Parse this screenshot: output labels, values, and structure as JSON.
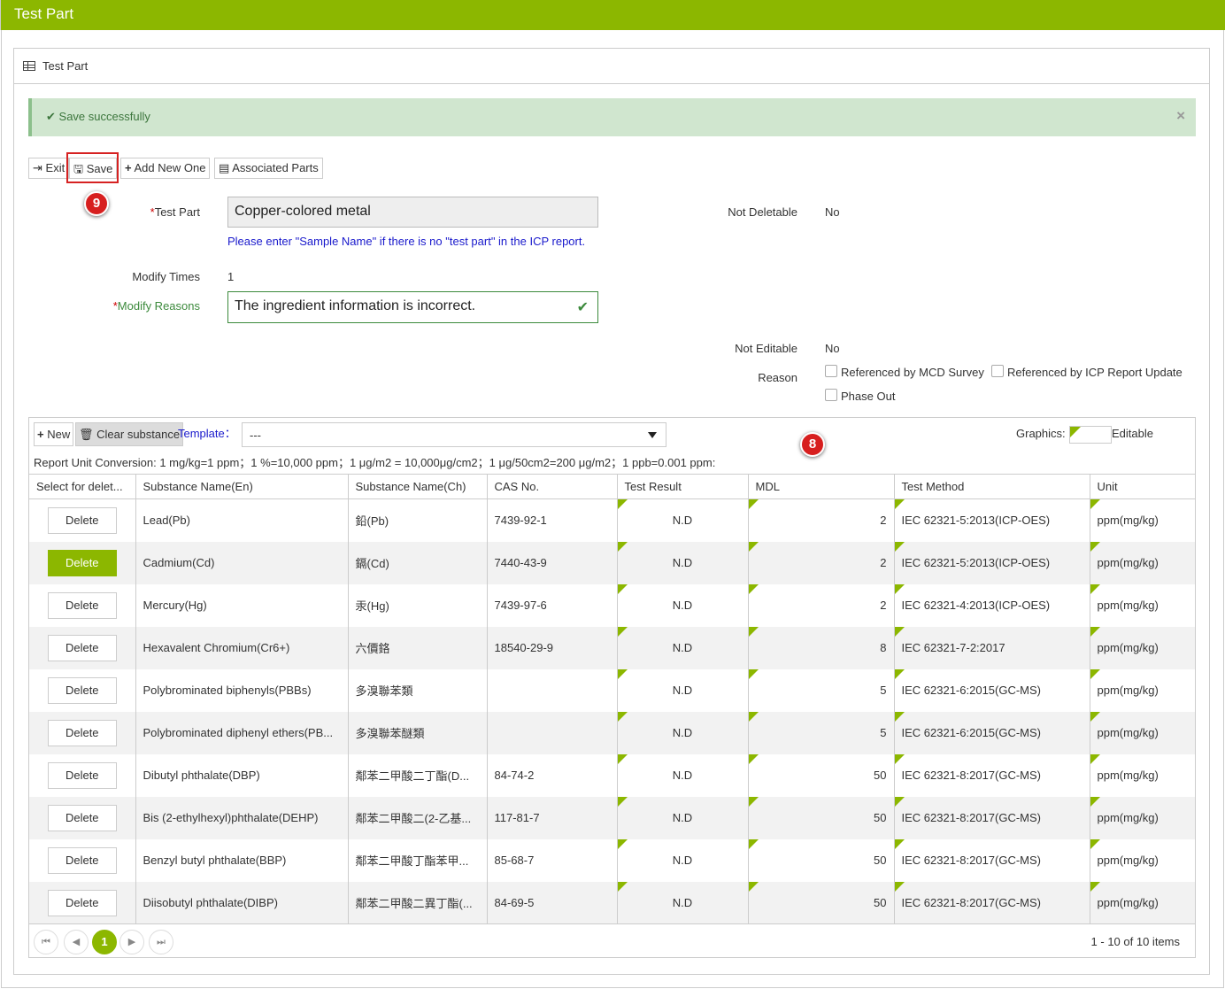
{
  "header": {
    "title": "Test Part"
  },
  "panel": {
    "title": "Test Part"
  },
  "alert": {
    "message": "Save successfully",
    "close": "×"
  },
  "toolbar": {
    "exit": "Exit",
    "save": "Save",
    "add_new": "Add New One",
    "associated": "Associated Parts"
  },
  "badges": {
    "save_step": "9",
    "grid_step": "8"
  },
  "form": {
    "test_part_label": "Test Part",
    "test_part_value": "Copper-colored metal",
    "test_part_hint": "Please enter \"Sample Name\" if there is no \"test part\" in the ICP report.",
    "not_deletable_label": "Not Deletable",
    "not_deletable_value": "No",
    "modify_times_label": "Modify Times",
    "modify_times_value": "1",
    "modify_reasons_label": "Modify Reasons",
    "modify_reasons_value": "The ingredient information is incorrect.",
    "not_editable_label": "Not Editable",
    "not_editable_value": "No",
    "reason_label": "Reason",
    "reason_options": [
      "Referenced by MCD Survey",
      "Referenced by ICP Report Update",
      "Phase Out"
    ],
    "required_mark": "*"
  },
  "grid": {
    "new": "New",
    "clear": "Clear substance",
    "template_label": "Template：",
    "template_value": "---",
    "graphics_label": "Graphics:",
    "editable_label": "Editable",
    "conversion": "Report Unit Conversion: 1 mg/kg=1 ppm；1 %=10,000 ppm；1 μg/m2 = 10,000μg/cm2；1 μg/50cm2=200 μg/m2；1 ppb=0.001 ppm:",
    "columns": [
      "Select for delet...",
      "Substance Name(En)",
      "Substance Name(Ch)",
      "CAS No.",
      "Test Result",
      "MDL",
      "Test Method",
      "Unit"
    ],
    "delete_label": "Delete",
    "rows": [
      {
        "en": "Lead(Pb)",
        "ch": "鉛(Pb)",
        "cas": "7439-92-1",
        "result": "N.D",
        "mdl": "2",
        "method": "IEC 62321-5:2013(ICP-OES)",
        "unit": "ppm(mg/kg)"
      },
      {
        "en": "Cadmium(Cd)",
        "ch": "鎘(Cd)",
        "cas": "7440-43-9",
        "result": "N.D",
        "mdl": "2",
        "method": "IEC 62321-5:2013(ICP-OES)",
        "unit": "ppm(mg/kg)"
      },
      {
        "en": "Mercury(Hg)",
        "ch": "汞(Hg)",
        "cas": "7439-97-6",
        "result": "N.D",
        "mdl": "2",
        "method": "IEC 62321-4:2013(ICP-OES)",
        "unit": "ppm(mg/kg)"
      },
      {
        "en": "Hexavalent Chromium(Cr6+)",
        "ch": "六價鉻",
        "cas": "18540-29-9",
        "result": "N.D",
        "mdl": "8",
        "method": "IEC 62321-7-2:2017",
        "unit": "ppm(mg/kg)"
      },
      {
        "en": "Polybrominated biphenyls(PBBs)",
        "ch": "多溴聯苯類",
        "cas": "",
        "result": "N.D",
        "mdl": "5",
        "method": "IEC 62321-6:2015(GC-MS)",
        "unit": "ppm(mg/kg)"
      },
      {
        "en": "Polybrominated diphenyl ethers(PB...",
        "ch": "多溴聯苯醚類",
        "cas": "",
        "result": "N.D",
        "mdl": "5",
        "method": "IEC 62321-6:2015(GC-MS)",
        "unit": "ppm(mg/kg)"
      },
      {
        "en": "Dibutyl phthalate(DBP)",
        "ch": "鄰苯二甲酸二丁酯(D...",
        "cas": "84-74-2",
        "result": "N.D",
        "mdl": "50",
        "method": "IEC 62321-8:2017(GC-MS)",
        "unit": "ppm(mg/kg)"
      },
      {
        "en": "Bis (2-ethylhexyl)phthalate(DEHP)",
        "ch": "鄰苯二甲酸二(2-乙基...",
        "cas": "117-81-7",
        "result": "N.D",
        "mdl": "50",
        "method": "IEC 62321-8:2017(GC-MS)",
        "unit": "ppm(mg/kg)"
      },
      {
        "en": "Benzyl butyl phthalate(BBP)",
        "ch": "鄰苯二甲酸丁酯苯甲...",
        "cas": "85-68-7",
        "result": "N.D",
        "mdl": "50",
        "method": "IEC 62321-8:2017(GC-MS)",
        "unit": "ppm(mg/kg)"
      },
      {
        "en": "Diisobutyl phthalate(DIBP)",
        "ch": "鄰苯二甲酸二異丁酯(...",
        "cas": "84-69-5",
        "result": "N.D",
        "mdl": "50",
        "method": "IEC 62321-8:2017(GC-MS)",
        "unit": "ppm(mg/kg)"
      }
    ],
    "active_delete_row": 1
  },
  "pager": {
    "first": "⏮",
    "prev": "◀",
    "current": "1",
    "next": "▶",
    "last": "⏭",
    "info": "1 - 10 of 10 items"
  },
  "colors": {
    "accent": "#8cb700",
    "success_bg": "#d0e6cf",
    "success_text": "#3c763d",
    "badge": "#d71f1f"
  }
}
